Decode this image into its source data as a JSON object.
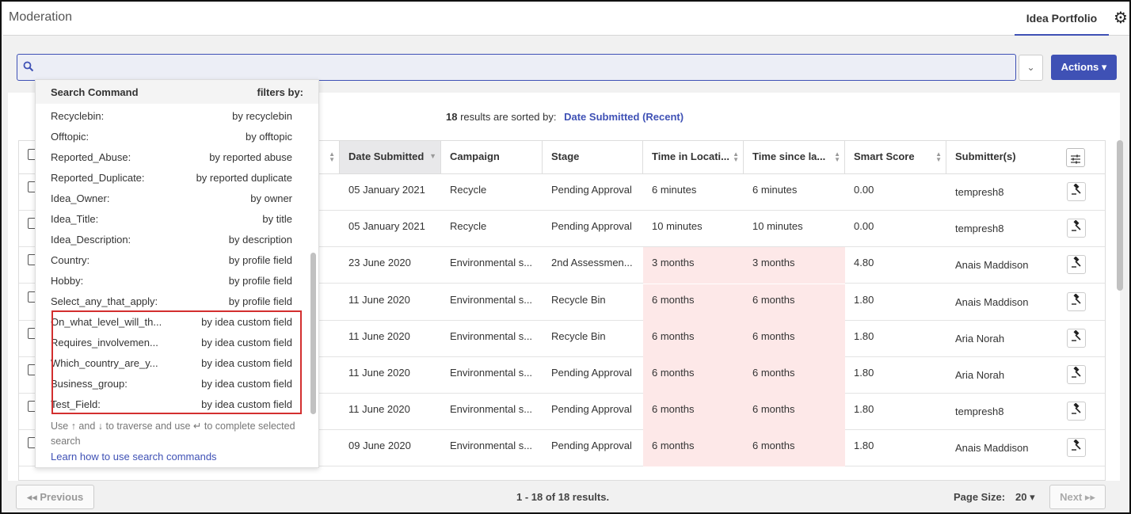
{
  "header": {
    "title": "Moderation",
    "tab": "Idea Portfolio",
    "settings_icon": "gear-icon"
  },
  "search": {
    "value": "",
    "placeholder": "",
    "actions_label": "Actions",
    "dropdown_caret": "⌄"
  },
  "results": {
    "count": "18",
    "sorted_text": "results are sorted by:",
    "sort_field": "Date Submitted (Recent)"
  },
  "table": {
    "columns": [
      "Date Submitted",
      "Campaign",
      "Stage",
      "Time in Locati...",
      "Time since la...",
      "Smart Score",
      "Submitter(s)"
    ],
    "rows": [
      {
        "date": "05 January 2021",
        "campaign": "Recycle",
        "stage": "Pending Approval",
        "time_loc": "6 minutes",
        "time_since": "6 minutes",
        "score": "0.00",
        "submitter": "tempresh8",
        "warn": false
      },
      {
        "date": "05 January 2021",
        "campaign": "Recycle",
        "stage": "Pending Approval",
        "time_loc": "10 minutes",
        "time_since": "10 minutes",
        "score": "0.00",
        "submitter": "tempresh8",
        "warn": false
      },
      {
        "date": "23 June 2020",
        "campaign": "Environmental s...",
        "stage": "2nd Assessmen...",
        "time_loc": "3 months",
        "time_since": "3 months",
        "score": "4.80",
        "submitter": "Anais Maddison",
        "warn": true
      },
      {
        "date": "11 June 2020",
        "campaign": "Environmental s...",
        "stage": "Recycle Bin",
        "time_loc": "6 months",
        "time_since": "6 months",
        "score": "1.80",
        "submitter": "Anais Maddison",
        "warn": true
      },
      {
        "date": "11 June 2020",
        "campaign": "Environmental s...",
        "stage": "Recycle Bin",
        "time_loc": "6 months",
        "time_since": "6 months",
        "score": "1.80",
        "submitter": "Aria Norah",
        "warn": true
      },
      {
        "date": "11 June 2020",
        "campaign": "Environmental s...",
        "stage": "Pending Approval",
        "time_loc": "6 months",
        "time_since": "6 months",
        "score": "1.80",
        "submitter": "Aria Norah",
        "warn": true
      },
      {
        "date": "11 June 2020",
        "campaign": "Environmental s...",
        "stage": "Pending Approval",
        "time_loc": "6 months",
        "time_since": "6 months",
        "score": "1.80",
        "submitter": "tempresh8",
        "warn": true
      },
      {
        "date": "09 June 2020",
        "campaign": "Environmental s...",
        "stage": "Pending Approval",
        "time_loc": "6 months",
        "time_since": "6 months",
        "score": "1.80",
        "submitter": "Anais Maddison",
        "warn": true
      }
    ]
  },
  "dropdown": {
    "header_left": "Search Command",
    "header_right": "filters by:",
    "items": [
      {
        "key": "Recyclebin:",
        "val": "by recyclebin"
      },
      {
        "key": "Offtopic:",
        "val": "by offtopic"
      },
      {
        "key": "Reported_Abuse:",
        "val": "by reported abuse"
      },
      {
        "key": "Reported_Duplicate:",
        "val": "by reported duplicate"
      },
      {
        "key": "Idea_Owner:",
        "val": "by owner"
      },
      {
        "key": "Idea_Title:",
        "val": "by title"
      },
      {
        "key": "Idea_Description:",
        "val": "by description"
      },
      {
        "key": "Country:",
        "val": "by profile field"
      },
      {
        "key": "Hobby:",
        "val": "by profile field"
      },
      {
        "key": "Select_any_that_apply:",
        "val": "by profile field"
      },
      {
        "key": "On_what_level_will_th...",
        "val": "by idea custom field"
      },
      {
        "key": "Requires_involvemen...",
        "val": "by idea custom field"
      },
      {
        "key": "Which_country_are_y...",
        "val": "by idea custom field"
      },
      {
        "key": "Business_group:",
        "val": "by idea custom field"
      },
      {
        "key": "Test_Field:",
        "val": "by idea custom field"
      }
    ],
    "hint": "Use ↑ and ↓ to traverse and use ↵ to complete selected search",
    "learn_link": "Learn how to use search commands"
  },
  "footer": {
    "prev": "◂◂ Previous",
    "count": "1 - 18 of 18 results.",
    "page_size_label": "Page Size:",
    "page_size": "20",
    "next": "Next ▸▸"
  }
}
